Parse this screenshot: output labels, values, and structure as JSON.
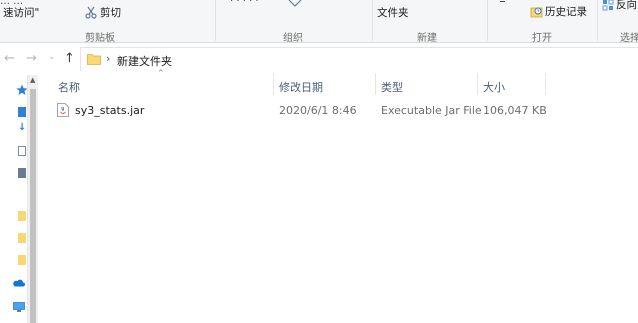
{
  "ribbon": {
    "quick_access_label": "速访问\"",
    "cut_label": "剪切",
    "new_folder_label": "文件夹",
    "history_label": "历史记录",
    "reverse_select_label": "反向",
    "groups": {
      "clipboard": "剪贴板",
      "organize": "组织",
      "new": "新建",
      "open": "打开",
      "select": "选择"
    }
  },
  "address": {
    "folder_name": "新建文件夹",
    "separator": "›"
  },
  "columns": {
    "name": "名称",
    "date": "修改日期",
    "type": "类型",
    "size": "大小"
  },
  "files": [
    {
      "name": "sy3_stats.jar",
      "date": "2020/6/1 8:46",
      "type": "Executable Jar File",
      "size": "106,047 KB"
    }
  ],
  "icons": [
    "scissors-icon",
    "folder-icon",
    "history-icon",
    "select-icon",
    "jar-file-icon",
    "onedrive-icon",
    "pc-icon"
  ],
  "colors": {
    "ribbon_bg": "#f5f6f7",
    "header_text": "#4c607a",
    "folder_yellow": "#f8d775",
    "onedrive_blue": "#0f78d4"
  }
}
